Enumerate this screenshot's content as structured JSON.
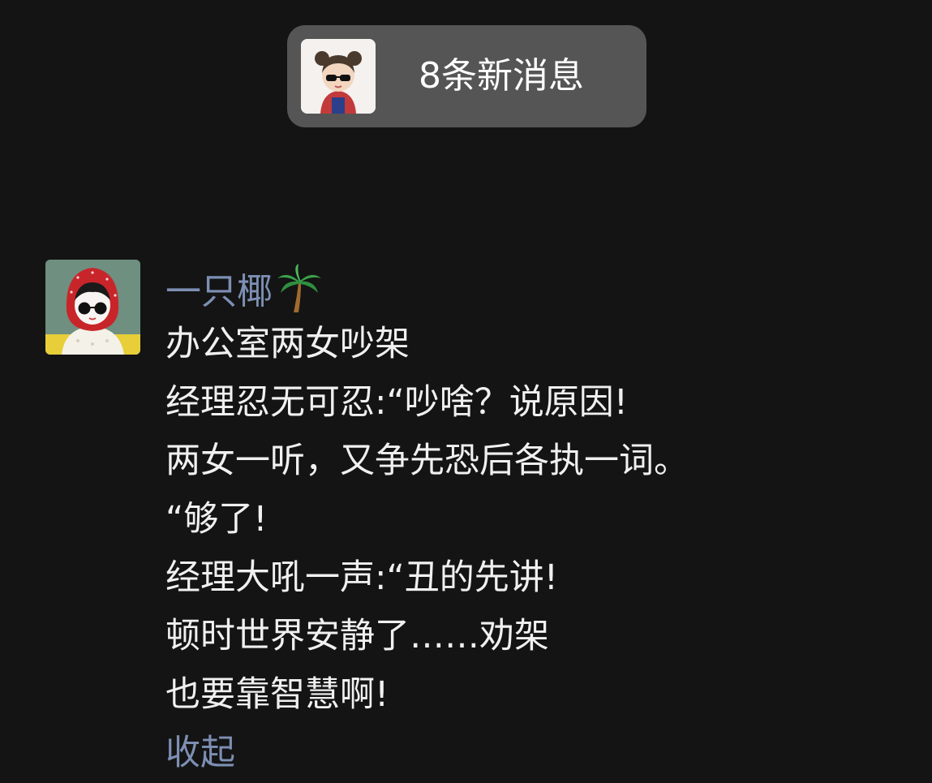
{
  "notification": {
    "text": "8条新消息"
  },
  "post": {
    "author": {
      "name": "一只椰",
      "emoji_icon": "palm-tree-icon"
    },
    "lines": [
      "办公室两女吵架",
      "经理忍无可忍:“吵啥？说原因!",
      "两女一听，又争先恐后各执一词。",
      "“够了!",
      "经理大吼一声:“丑的先讲!",
      "顿时世界安静了……劝架",
      "也要靠智慧啊!"
    ],
    "collapse_label": "收起"
  },
  "colors": {
    "background": "#141414",
    "pill_background": "#555555",
    "author_name": "#7d8fb3",
    "message_text": "#f0f0f0",
    "link": "#7d8fb3"
  }
}
